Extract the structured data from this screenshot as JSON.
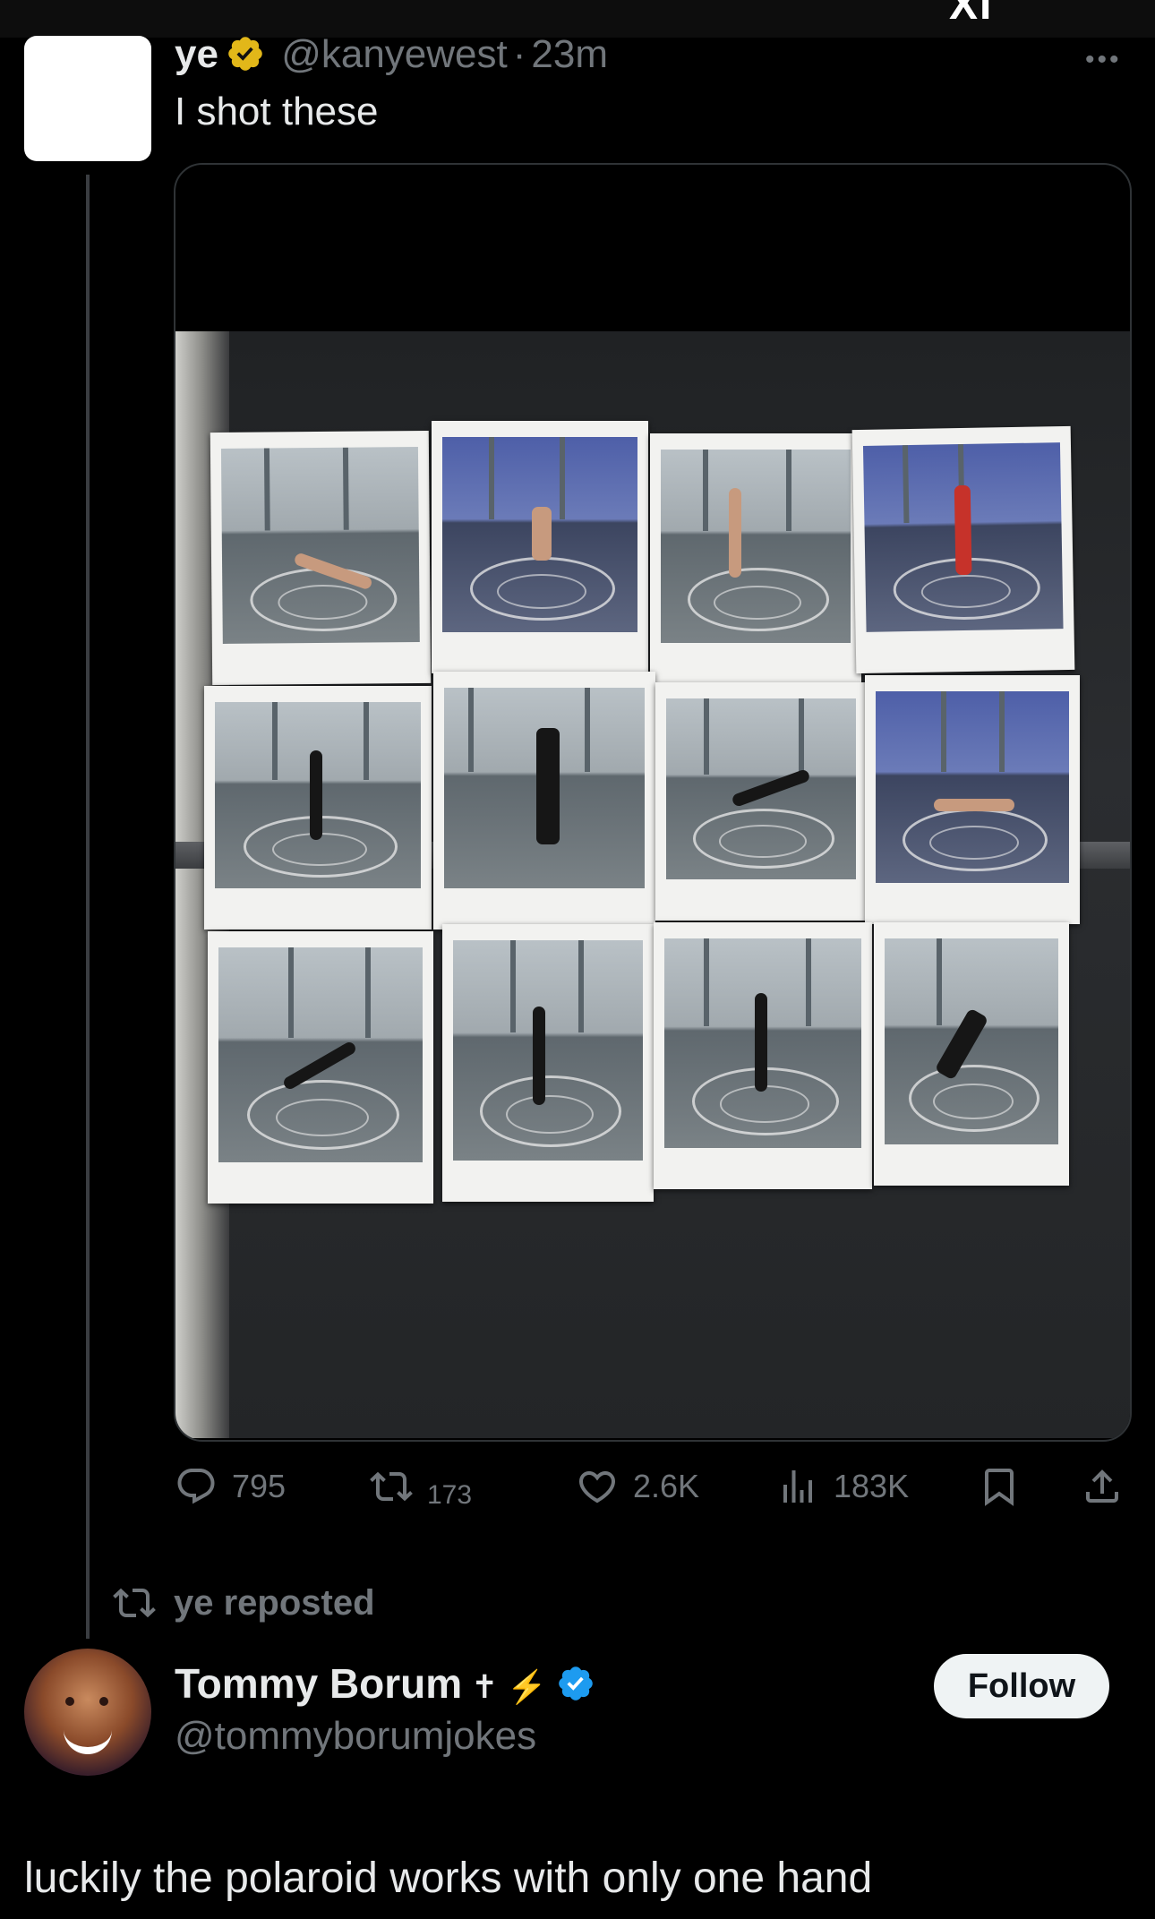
{
  "top_bar": {
    "glyph": "XI"
  },
  "original_tweet": {
    "display_name": "ye",
    "handle": "@kanyewest",
    "separator": "·",
    "time": "23m",
    "text": "I shot these",
    "more": "•••",
    "stats": {
      "replies": "795",
      "reposts": "173",
      "likes": "2.6K",
      "views": "183K"
    }
  },
  "repost_label": "ye reposted",
  "reposted_tweet": {
    "display_name": "Tommy Borum",
    "name_emojis": "✝ ⚡",
    "handle": "@tommyborumjokes",
    "follow_label": "Follow",
    "text": "luckily the polaroid works with only one hand"
  },
  "colors": {
    "background": "#000000",
    "text_primary": "#e7e9ea",
    "text_secondary": "#71767b",
    "verified_gold": "#e2b719",
    "verified_blue": "#1d9bf0",
    "follow_button_bg": "#eff3f4"
  },
  "icons": [
    "reply-icon",
    "repost-icon",
    "like-icon",
    "views-icon",
    "bookmark-icon",
    "share-icon",
    "verified-gold-icon",
    "verified-blue-icon"
  ]
}
